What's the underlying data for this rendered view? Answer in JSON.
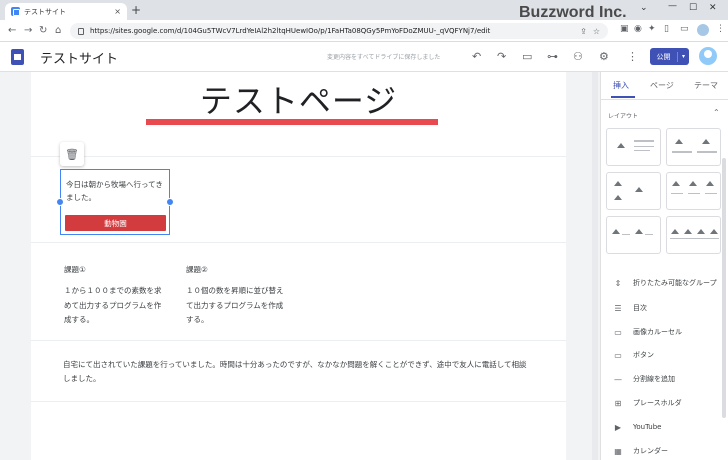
{
  "browser": {
    "tab_title": "テストサイト",
    "tab_close": "×",
    "new_tab": "+",
    "url": "https://sites.google.com/d/104Gu5TWcV7LrdYeIAl2h2ltqHUewIOo/p/1FaHTa08QGy5PmYoFDoZMUU-_qVQFYNj7/edit",
    "back": "←",
    "forward": "→",
    "reload": "↻",
    "home": "⌂",
    "bookmark": "☆",
    "minimize": "—",
    "maximize": "☐",
    "close": "✕",
    "caret": "⌄"
  },
  "watermark": "Buzzword Inc.",
  "app": {
    "site_name": "テストサイト",
    "save_status": "変更内容をすべてドライブに保存しました",
    "publish_label": "公開",
    "publish_caret": "▾",
    "undo": "↶",
    "redo": "↷",
    "more": "⋮"
  },
  "page": {
    "title": "テストページ",
    "accent_color": "#e84a4f",
    "trash": "🗑",
    "textbox_text": "今日は朝から牧場へ行ってきました。",
    "button_label": "動物園",
    "col1_heading": "課題①",
    "col1_body": "１から１００までの素数を求めて出力するプログラムを作成する。",
    "col2_heading": "課題②",
    "col2_body": "１０個の数を昇順に並び替えて出力するプログラムを作成する。",
    "paragraph": "自宅にて出されていた課題を行っていました。時間は十分あったのですが、なかなか問題を解くことができず、途中で友人に電話して相談しました。"
  },
  "panel": {
    "tabs": [
      "挿入",
      "ページ",
      "テーマ"
    ],
    "layout_heading": "レイアウト",
    "layout_caret": "⌃",
    "items": [
      {
        "icon": "⇕",
        "label": "折りたたみ可能なグループ"
      },
      {
        "icon": "☰",
        "label": "目次"
      },
      {
        "icon": "▭",
        "label": "画像カルーセル"
      },
      {
        "icon": "▭",
        "label": "ボタン"
      },
      {
        "icon": "—",
        "label": "分割線を追加"
      },
      {
        "icon": "⊞",
        "label": "プレースホルダ"
      },
      {
        "icon": "▶",
        "label": "YouTube"
      },
      {
        "icon": "▦",
        "label": "カレンダー"
      }
    ]
  }
}
